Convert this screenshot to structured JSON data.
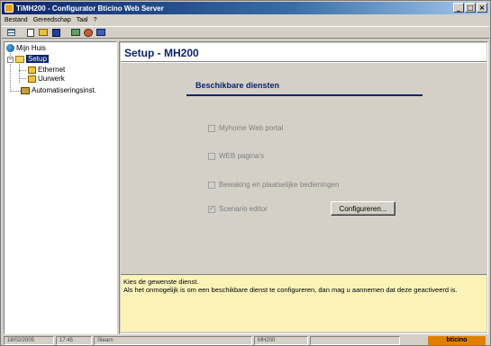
{
  "window": {
    "title": "TiMH200 - Configurator Bticino Web Server",
    "controls": {
      "minimize": "_",
      "maximize": "□",
      "close": "×"
    }
  },
  "menu": [
    "Bestand",
    "Gereedschap",
    "Taal",
    "?"
  ],
  "tree": {
    "root": "Mijn Huis",
    "setup": "Setup",
    "children": [
      "Ethernet",
      "Uurwerk"
    ],
    "automation": "Automatiseringsinst."
  },
  "main": {
    "page_title": "Setup - MH200",
    "section_title": "Beschikbare diensten",
    "services": [
      {
        "label": "Myhome Web portal",
        "checked": false
      },
      {
        "label": "WEB pagina's",
        "checked": false
      },
      {
        "label": "Bewaking en plaatselijke bedieningen",
        "checked": false
      },
      {
        "label": "Scenario editor",
        "checked": true
      }
    ],
    "configure_button": "Configureren...",
    "help_line1": "Kies de gewenste dienst.",
    "help_line2": "Als het onmogelijk is om een beschikbare dienst te configureren, dan mag u aannemen dat deze geactiveerd is."
  },
  "status": {
    "date": "18/02/2005",
    "time": "17:45",
    "state": "Stearn",
    "device": "MH200",
    "brand": "bticino"
  }
}
